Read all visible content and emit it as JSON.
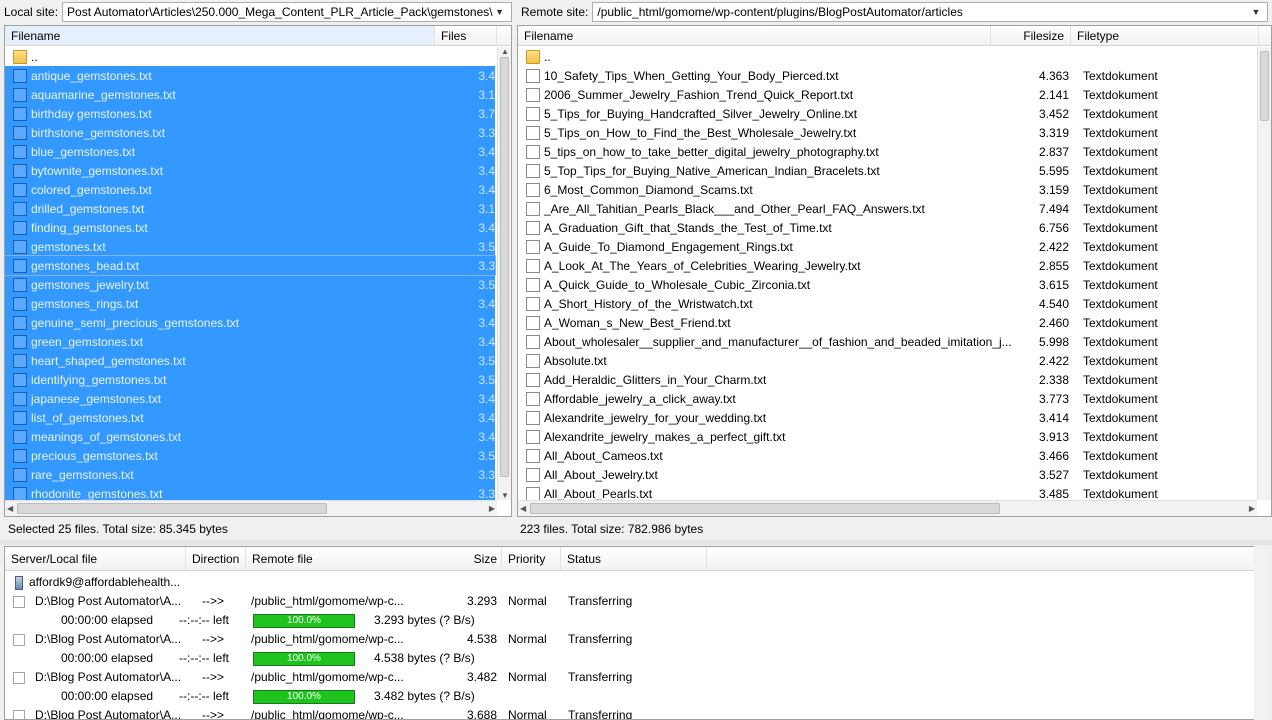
{
  "local_site": {
    "label": "Local site:",
    "path": "Post Automator\\Articles\\250.000_Mega_Content_PLR_Article_Pack\\gemstones\\"
  },
  "remote_site": {
    "label": "Remote site:",
    "path": "/public_html/gomome/wp-content/plugins/BlogPostAutomator/articles"
  },
  "local_columns": {
    "filename": "Filename",
    "filesize": "Files"
  },
  "remote_columns": {
    "filename": "Filename",
    "filesize": "Filesize",
    "filetype": "Filetype"
  },
  "local_files": [
    {
      "name": "..",
      "size": "",
      "type": "folder"
    },
    {
      "name": "antique_gemstones.txt",
      "size": "3.4",
      "sel": true
    },
    {
      "name": "aquamarine_gemstones.txt",
      "size": "3.1",
      "sel": true
    },
    {
      "name": "birthday gemstones.txt",
      "size": "3.7",
      "sel": true
    },
    {
      "name": "birthstone_gemstones.txt",
      "size": "3.3",
      "sel": true
    },
    {
      "name": "blue_gemstones.txt",
      "size": "3.4",
      "sel": true
    },
    {
      "name": "bytownite_gemstones.txt",
      "size": "3.4",
      "sel": true
    },
    {
      "name": "colored_gemstones.txt",
      "size": "3.4",
      "sel": true
    },
    {
      "name": "drilled_gemstones.txt",
      "size": "3.1",
      "sel": true
    },
    {
      "name": "finding_gemstones.txt",
      "size": "3.4",
      "sel": true
    },
    {
      "name": "gemstones.txt",
      "size": "3.5",
      "sel": true
    },
    {
      "name": "gemstones_bead.txt",
      "size": "3.3",
      "sel": true,
      "hover": true
    },
    {
      "name": "gemstones_jewelry.txt",
      "size": "3.5",
      "sel": true
    },
    {
      "name": "gemstones_rings.txt",
      "size": "3.4",
      "sel": true
    },
    {
      "name": "genuine_semi_precious_gemstones.txt",
      "size": "3.4",
      "sel": true
    },
    {
      "name": "green_gemstones.txt",
      "size": "3.4",
      "sel": true
    },
    {
      "name": "heart_shaped_gemstones.txt",
      "size": "3.5",
      "sel": true
    },
    {
      "name": "identifying_gemstones.txt",
      "size": "3.5",
      "sel": true
    },
    {
      "name": "japanese_gemstones.txt",
      "size": "3.4",
      "sel": true
    },
    {
      "name": "list_of_gemstones.txt",
      "size": "3.4",
      "sel": true
    },
    {
      "name": "meanings_of_gemstones.txt",
      "size": "3.4",
      "sel": true
    },
    {
      "name": "precious_gemstones.txt",
      "size": "3.5",
      "sel": true
    },
    {
      "name": "rare_gemstones.txt",
      "size": "3.3",
      "sel": true
    },
    {
      "name": "rhodonite_gemstones.txt",
      "size": "3.3",
      "sel": true
    }
  ],
  "remote_files": [
    {
      "name": "..",
      "size": "",
      "type": "",
      "folder": true
    },
    {
      "name": "10_Safety_Tips_When_Getting_Your_Body_Pierced.txt",
      "size": "4.363",
      "type": "Textdokument"
    },
    {
      "name": "2006_Summer_Jewelry_Fashion_Trend_Quick_Report.txt",
      "size": "2.141",
      "type": "Textdokument"
    },
    {
      "name": "5_Tips_for_Buying_Handcrafted_Silver_Jewelry_Online.txt",
      "size": "3.452",
      "type": "Textdokument"
    },
    {
      "name": "5_Tips_on_How_to_Find_the_Best_Wholesale_Jewelry.txt",
      "size": "3.319",
      "type": "Textdokument"
    },
    {
      "name": "5_tips_on_how_to_take_better_digital_jewelry_photography.txt",
      "size": "2.837",
      "type": "Textdokument"
    },
    {
      "name": "5_Top_Tips_for_Buying_Native_American_Indian_Bracelets.txt",
      "size": "5.595",
      "type": "Textdokument"
    },
    {
      "name": "6_Most_Common_Diamond_Scams.txt",
      "size": "3.159",
      "type": "Textdokument"
    },
    {
      "name": "_Are_All_Tahitian_Pearls_Black___and_Other_Pearl_FAQ_Answers.txt",
      "size": "7.494",
      "type": "Textdokument"
    },
    {
      "name": "A_Graduation_Gift_that_Stands_the_Test_of_Time.txt",
      "size": "6.756",
      "type": "Textdokument"
    },
    {
      "name": "A_Guide_To_Diamond_Engagement_Rings.txt",
      "size": "2.422",
      "type": "Textdokument"
    },
    {
      "name": "A_Look_At_The_Years_of_Celebrities_Wearing_Jewelry.txt",
      "size": "2.855",
      "type": "Textdokument"
    },
    {
      "name": "A_Quick_Guide_to_Wholesale_Cubic_Zirconia.txt",
      "size": "3.615",
      "type": "Textdokument"
    },
    {
      "name": "A_Short_History_of_the_Wristwatch.txt",
      "size": "4.540",
      "type": "Textdokument"
    },
    {
      "name": "A_Woman_s_New_Best_Friend.txt",
      "size": "2.460",
      "type": "Textdokument"
    },
    {
      "name": "About_wholesaler__supplier_and_manufacturer__of_fashion_and_beaded_imitation_j...",
      "size": "5.998",
      "type": "Textdokument"
    },
    {
      "name": "Absolute.txt",
      "size": "2.422",
      "type": "Textdokument"
    },
    {
      "name": "Add_Heraldic_Glitters_in_Your_Charm.txt",
      "size": "2.338",
      "type": "Textdokument"
    },
    {
      "name": "Affordable_jewelry_a_click_away.txt",
      "size": "3.773",
      "type": "Textdokument"
    },
    {
      "name": "Alexandrite_jewelry_for_your_wedding.txt",
      "size": "3.414",
      "type": "Textdokument"
    },
    {
      "name": "Alexandrite_jewelry_makes_a_perfect_gift.txt",
      "size": "3.913",
      "type": "Textdokument"
    },
    {
      "name": "All_About_Cameos.txt",
      "size": "3.466",
      "type": "Textdokument"
    },
    {
      "name": "All_About_Jewelry.txt",
      "size": "3.527",
      "type": "Textdokument"
    },
    {
      "name": "All_About_Pearls.txt",
      "size": "3.485",
      "type": "Textdokument"
    }
  ],
  "local_status": "Selected 25 files. Total size: 85.345 bytes",
  "remote_status": "223 files. Total size: 782.986 bytes",
  "queue_columns": {
    "server_local": "Server/Local file",
    "direction": "Direction",
    "remote_file": "Remote file",
    "size": "Size",
    "priority": "Priority",
    "status": "Status"
  },
  "queue_server": "affordk9@affordablehealth...",
  "queue_items": [
    {
      "local": "D:\\Blog Post Automator\\A...",
      "dir": "-->>",
      "remote": "/public_html/gomome/wp-c...",
      "size": "3.293",
      "priority": "Normal",
      "status": "Transferring",
      "elapsed": "00:00:00 elapsed",
      "left": "--:--:-- left",
      "progress": "100.0%",
      "progress_value": 100,
      "bytes": "3.293 bytes (? B/s)"
    },
    {
      "local": "D:\\Blog Post Automator\\A...",
      "dir": "-->>",
      "remote": "/public_html/gomome/wp-c...",
      "size": "4.538",
      "priority": "Normal",
      "status": "Transferring",
      "elapsed": "00:00:00 elapsed",
      "left": "--:--:-- left",
      "progress": "100.0%",
      "progress_value": 100,
      "bytes": "4.538 bytes (? B/s)"
    },
    {
      "local": "D:\\Blog Post Automator\\A...",
      "dir": "-->>",
      "remote": "/public_html/gomome/wp-c...",
      "size": "3.482",
      "priority": "Normal",
      "status": "Transferring",
      "elapsed": "00:00:00 elapsed",
      "left": "--:--:-- left",
      "progress": "100.0%",
      "progress_value": 100,
      "bytes": "3.482 bytes (? B/s)"
    },
    {
      "local": "D:\\Blog Post Automator\\A...",
      "dir": "-->>",
      "remote": "/public_html/gomome/wp-c...",
      "size": "3.688",
      "priority": "Normal",
      "status": "Transferring"
    }
  ],
  "colors": {
    "selection": "#3399ff",
    "progress": "#1ec31e",
    "folder": "#f3c14a"
  }
}
